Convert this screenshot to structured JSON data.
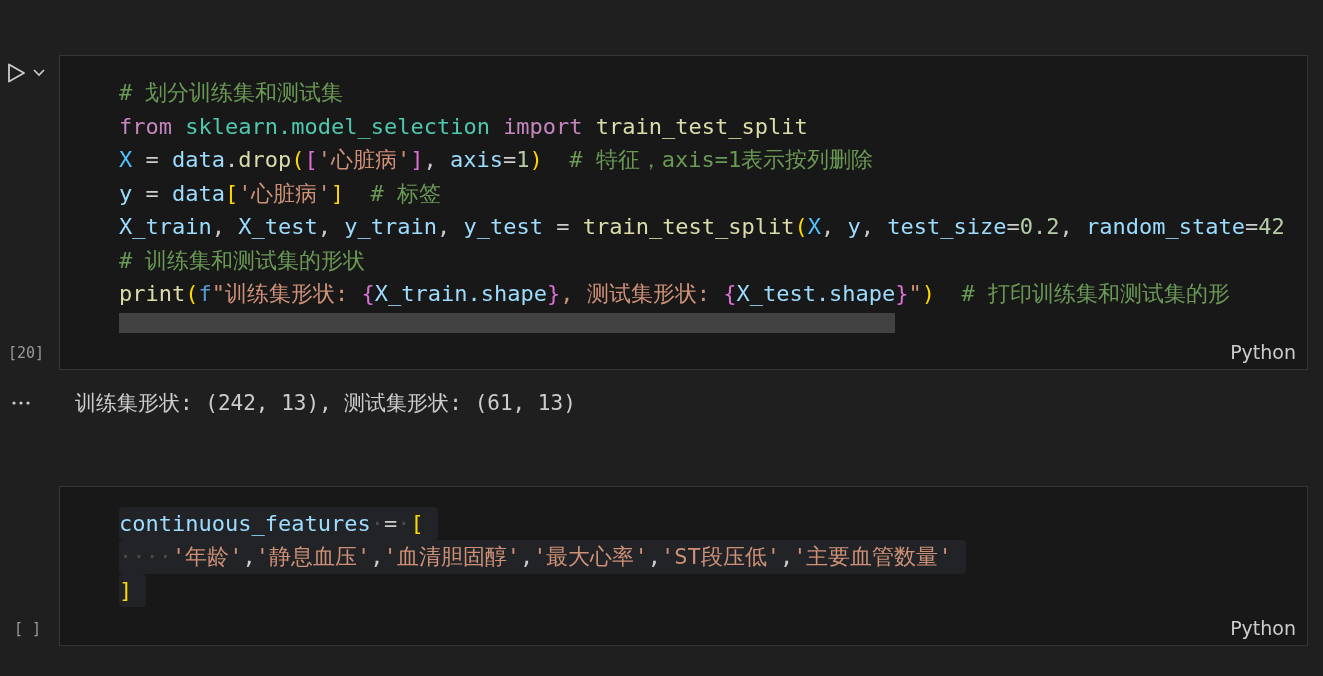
{
  "cells": [
    {
      "run_button": true,
      "execution_count": "[20]",
      "language": "Python",
      "scrollbar": true,
      "lines": [
        {
          "highlighted": false,
          "tokens": [
            {
              "kind": "comment",
              "text": "# 划分训练集和测试集"
            }
          ]
        },
        {
          "highlighted": false,
          "tokens": [
            {
              "kind": "keyword",
              "text": "from "
            },
            {
              "kind": "module",
              "text": "sklearn.model_selection "
            },
            {
              "kind": "keyword",
              "text": "import "
            },
            {
              "kind": "func",
              "text": "train_test_split"
            }
          ]
        },
        {
          "highlighted": false,
          "tokens": [
            {
              "kind": "constant",
              "text": "X"
            },
            {
              "kind": "plain",
              "text": " = "
            },
            {
              "kind": "variable",
              "text": "data"
            },
            {
              "kind": "plain",
              "text": "."
            },
            {
              "kind": "func",
              "text": "drop"
            },
            {
              "kind": "bracket1",
              "text": "("
            },
            {
              "kind": "bracket2",
              "text": "["
            },
            {
              "kind": "string",
              "text": "'心脏病'"
            },
            {
              "kind": "bracket2",
              "text": "]"
            },
            {
              "kind": "plain",
              "text": ", "
            },
            {
              "kind": "variable",
              "text": "axis"
            },
            {
              "kind": "plain",
              "text": "="
            },
            {
              "kind": "number",
              "text": "1"
            },
            {
              "kind": "bracket1",
              "text": ")"
            },
            {
              "kind": "comment",
              "text": "  # 特征，axis=1表示按列删除"
            }
          ]
        },
        {
          "highlighted": false,
          "tokens": [
            {
              "kind": "variable",
              "text": "y"
            },
            {
              "kind": "plain",
              "text": " = "
            },
            {
              "kind": "variable",
              "text": "data"
            },
            {
              "kind": "bracket1",
              "text": "["
            },
            {
              "kind": "string",
              "text": "'心脏病'"
            },
            {
              "kind": "bracket1",
              "text": "]"
            },
            {
              "kind": "comment",
              "text": "  # 标签"
            }
          ]
        },
        {
          "highlighted": false,
          "tokens": [
            {
              "kind": "variable",
              "text": "X_train"
            },
            {
              "kind": "plain",
              "text": ", "
            },
            {
              "kind": "variable",
              "text": "X_test"
            },
            {
              "kind": "plain",
              "text": ", "
            },
            {
              "kind": "variable",
              "text": "y_train"
            },
            {
              "kind": "plain",
              "text": ", "
            },
            {
              "kind": "variable",
              "text": "y_test"
            },
            {
              "kind": "plain",
              "text": " = "
            },
            {
              "kind": "func",
              "text": "train_test_split"
            },
            {
              "kind": "bracket1",
              "text": "("
            },
            {
              "kind": "constant",
              "text": "X"
            },
            {
              "kind": "plain",
              "text": ", "
            },
            {
              "kind": "variable",
              "text": "y"
            },
            {
              "kind": "plain",
              "text": ", "
            },
            {
              "kind": "variable",
              "text": "test_size"
            },
            {
              "kind": "plain",
              "text": "="
            },
            {
              "kind": "number",
              "text": "0.2"
            },
            {
              "kind": "plain",
              "text": ", "
            },
            {
              "kind": "variable",
              "text": "random_state"
            },
            {
              "kind": "plain",
              "text": "="
            },
            {
              "kind": "number",
              "text": "42"
            }
          ]
        },
        {
          "highlighted": false,
          "tokens": [
            {
              "kind": "comment",
              "text": "# 训练集和测试集的形状"
            }
          ]
        },
        {
          "highlighted": false,
          "tokens": [
            {
              "kind": "func",
              "text": "print"
            },
            {
              "kind": "bracket1",
              "text": "("
            },
            {
              "kind": "prefix",
              "text": "f"
            },
            {
              "kind": "string",
              "text": "\"训练集形状: "
            },
            {
              "kind": "bracket2",
              "text": "{"
            },
            {
              "kind": "variable",
              "text": "X_train.shape"
            },
            {
              "kind": "bracket2",
              "text": "}"
            },
            {
              "kind": "string",
              "text": ", 测试集形状: "
            },
            {
              "kind": "bracket2",
              "text": "{"
            },
            {
              "kind": "variable",
              "text": "X_test.shape"
            },
            {
              "kind": "bracket2",
              "text": "}"
            },
            {
              "kind": "string",
              "text": "\""
            },
            {
              "kind": "bracket1",
              "text": ")"
            },
            {
              "kind": "comment",
              "text": "  # 打印训练集和测试集的形"
            }
          ]
        }
      ],
      "output": "训练集形状: (242, 13), 测试集形状: (61, 13)"
    },
    {
      "run_button": false,
      "execution_count": "[ ]",
      "language": "Python",
      "scrollbar": false,
      "lines": [
        {
          "highlighted": true,
          "tokens": [
            {
              "kind": "variable",
              "text": "continuous_features"
            },
            {
              "kind": "whitespace",
              "text": "·"
            },
            {
              "kind": "plain",
              "text": "="
            },
            {
              "kind": "whitespace",
              "text": "·"
            },
            {
              "kind": "bracket1",
              "text": "["
            }
          ]
        },
        {
          "highlighted": true,
          "tokens": [
            {
              "kind": "whitespace",
              "text": "····"
            },
            {
              "kind": "string",
              "text": "'年龄'"
            },
            {
              "kind": "plain",
              "text": ","
            },
            {
              "kind": "string",
              "text": "'静息血压'"
            },
            {
              "kind": "plain",
              "text": ","
            },
            {
              "kind": "string",
              "text": "'血清胆固醇'"
            },
            {
              "kind": "plain",
              "text": ","
            },
            {
              "kind": "string",
              "text": "'最大心率'"
            },
            {
              "kind": "plain",
              "text": ","
            },
            {
              "kind": "string",
              "text": "'ST段压低'"
            },
            {
              "kind": "plain",
              "text": ","
            },
            {
              "kind": "string",
              "text": "'主要血管数量'"
            }
          ]
        },
        {
          "highlighted": true,
          "tokens": [
            {
              "kind": "bracket1",
              "text": "]"
            }
          ]
        }
      ]
    }
  ]
}
